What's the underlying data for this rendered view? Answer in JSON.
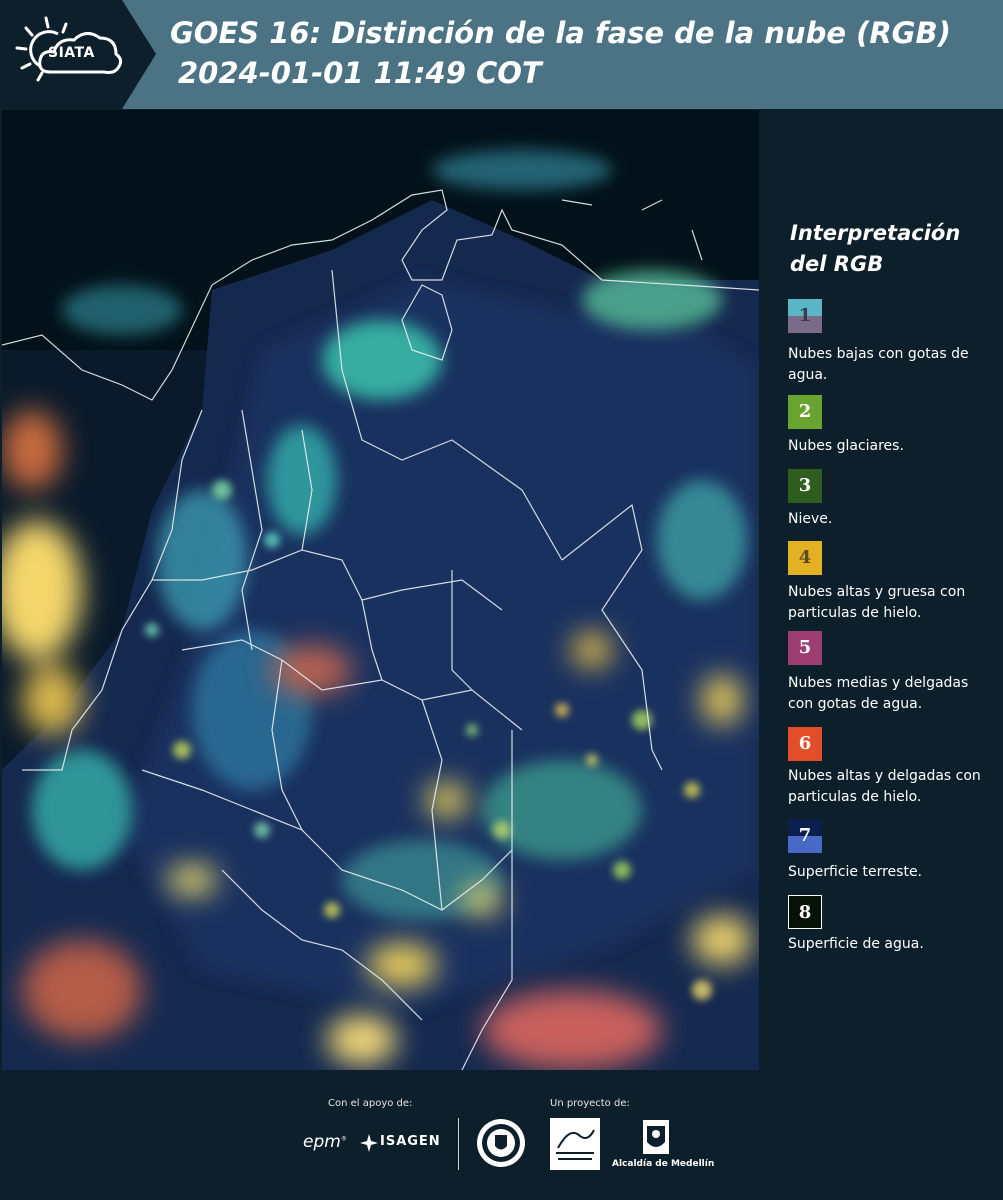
{
  "header": {
    "logo_text": "SIATA",
    "title_line1": "GOES 16: Distinción de la fase de la nube (RGB)",
    "title_line2": "2024-01-01 11:49 COT"
  },
  "map": {
    "icon": "satellite-map-image"
  },
  "legend": {
    "title_line1": "Interpretación",
    "title_line2": "del RGB",
    "items": [
      {
        "number": "1",
        "label": "Nubes bajas con gotas de agua.",
        "color_top": "#5ab6c6",
        "color_bottom": "#7a6b88"
      },
      {
        "number": "2",
        "label": "Nubes glaciares.",
        "color_top": "#69a431",
        "color_bottom": "#69a431"
      },
      {
        "number": "3",
        "label": "Nieve.",
        "color_top": "#2f5c1f",
        "color_bottom": "#2f5c1f"
      },
      {
        "number": "4",
        "label": "Nubes altas y gruesa con particulas de hielo.",
        "color_top": "#e3b124",
        "color_bottom": "#e3b124"
      },
      {
        "number": "5",
        "label": "Nubes medias y delgadas con gotas de agua.",
        "color_top": "#9c3e72",
        "color_bottom": "#9c3e72"
      },
      {
        "number": "6",
        "label": "Nubes altas y delgadas con particulas de hielo.",
        "color_top": "#e24e28",
        "color_bottom": "#e24e28"
      },
      {
        "number": "7",
        "label": "Superficie terreste.",
        "color_top": "#0b1f4e",
        "color_bottom": "#4869c5"
      },
      {
        "number": "8",
        "label": "Superficie de agua.",
        "color_top": "#061108",
        "color_bottom": "#061108"
      }
    ]
  },
  "footer": {
    "support_caption": "Con el apoyo de:",
    "project_caption": "Un proyecto de:",
    "epm": "epm",
    "isagen": "ISAGEN",
    "alcaldia": "Alcaldía de Medellín"
  }
}
